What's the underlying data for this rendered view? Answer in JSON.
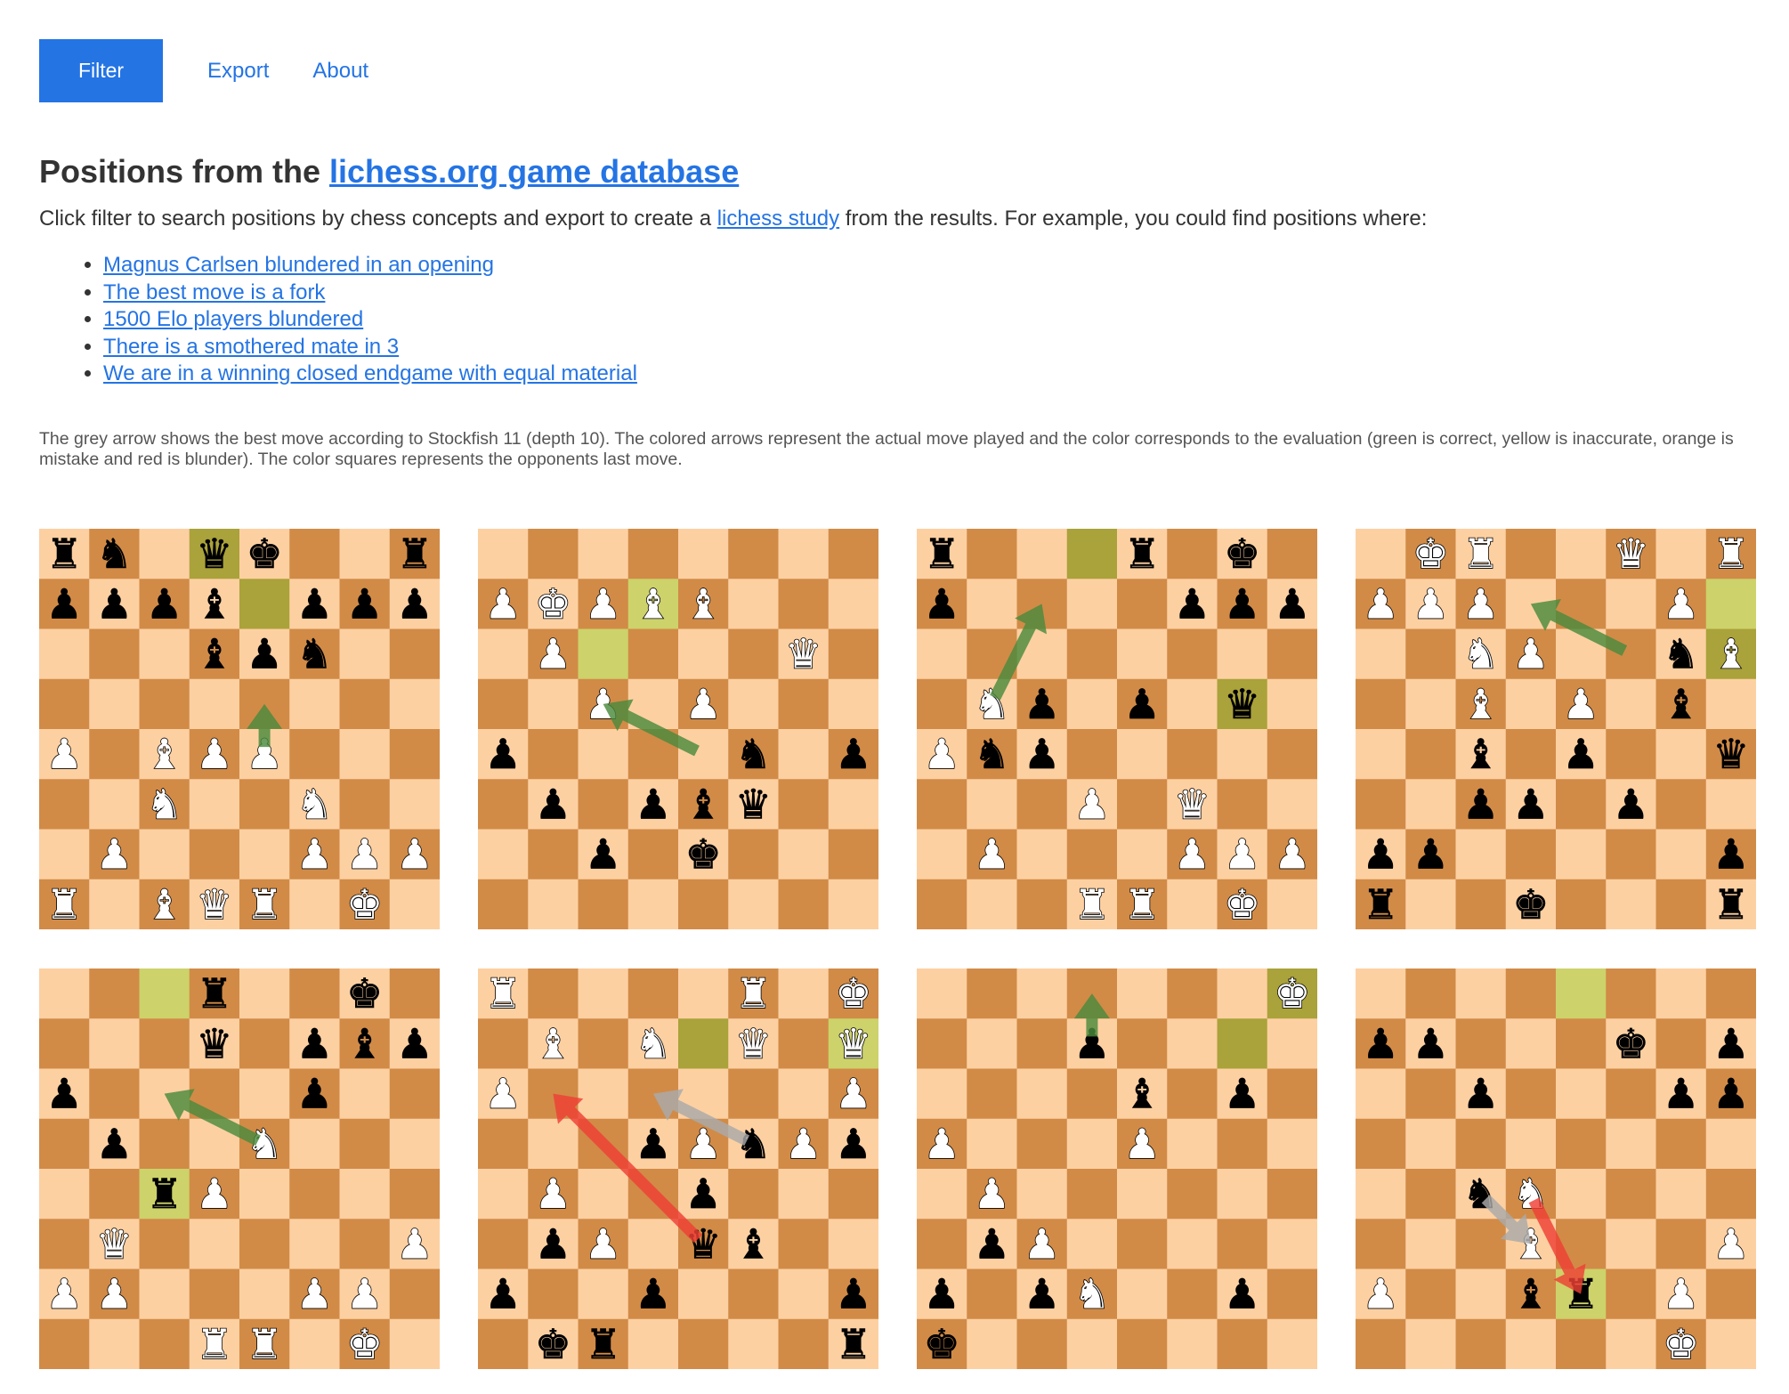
{
  "nav": {
    "filter_label": "Filter",
    "export_label": "Export",
    "about_label": "About"
  },
  "heading": {
    "prefix": "Positions from the ",
    "link": "lichess.org game database"
  },
  "intro": {
    "text1": "Click filter to search positions by chess concepts and export to create a ",
    "link": "lichess study",
    "text2": " from the results. For example, you could find positions where:"
  },
  "examples": [
    "Magnus Carlsen blundered in an opening",
    "The best move is a fork",
    "1500 Elo players blundered",
    "There is a smothered mate in 3",
    "We are in a winning closed endgame with equal material"
  ],
  "note": "The grey arrow shows the best move according to Stockfish 11 (depth 10). The colored arrows represent the actual move played and the color corresponds to the evaluation (green is correct, yellow is inaccurate, orange is mistake and red is blunder). The color squares represents the opponents last move.",
  "colors": {
    "light_square": "#fdd0a2",
    "dark_square": "#d18b47",
    "last_move_light": "#cdd26a",
    "last_move_dark": "#aaa23a",
    "arrow_green": "#4a8a3c",
    "arrow_red": "#ee4035",
    "arrow_grey": "#aaaaaa",
    "accent": "#2474e4"
  },
  "boards": [
    {
      "fen": "rn1qk2r/pppb1ppp/3bpn2/8/P1BPP3/2N2N2/1P3PPP/R1BQR1K1",
      "highlights": [
        "d8",
        "e7"
      ],
      "arrows": [
        {
          "from": "e4",
          "to": "e5",
          "color": "green"
        }
      ]
    },
    {
      "fen": "8/PKPBB3/1P4Q1/2P1P3/p4n1p/1p1pbq2/2p1k3/8",
      "highlights": [
        "d7",
        "c6"
      ],
      "arrows": [
        {
          "from": "e4",
          "to": "c5",
          "color": "green"
        }
      ]
    },
    {
      "fen": "r3r1k1/p4ppp/8/1Np1p1q1/Pnp5/3P1Q2/1P3PPP/3RR1K1",
      "highlights": [
        "d8",
        "g5"
      ],
      "arrows": [
        {
          "from": "b5",
          "to": "c7",
          "color": "green"
        }
      ]
    },
    {
      "fen": "1KR2Q1R/PPP3P1/2NP2nB/2B1P1b1/2b1p2q/2pp1p2/pp5p/r2k3r",
      "highlights": [
        "h7",
        "h6"
      ],
      "arrows": [
        {
          "from": "f6",
          "to": "d7",
          "color": "green"
        }
      ]
    },
    {
      "fen": "3r2k1/3q1pbp/p4p2/1p2N3/2rP4/1Q5P/PP3PP1/3RR1K1",
      "highlights": [
        "c8",
        "c4"
      ],
      "arrows": [
        {
          "from": "e5",
          "to": "c6",
          "color": "green"
        }
      ]
    },
    {
      "fen": "R4R1K/1B1N1Q1Q/P6P/3pPnPp/1P2p3/1pP1qb2/p2p3p/1kr4r",
      "highlights": [
        "e7",
        "h7"
      ],
      "arrows": [
        {
          "from": "e3",
          "to": "b6",
          "color": "red"
        },
        {
          "from": "f5",
          "to": "d6",
          "color": "grey"
        }
      ]
    },
    {
      "fen": "7K/3p4/4b1p1/P3P3/1P6/1pP5/p1pN2p1/k7",
      "highlights": [
        "h8",
        "g7"
      ],
      "arrows": [
        {
          "from": "d7",
          "to": "d8",
          "color": "green"
        }
      ]
    },
    {
      "fen": "8/pp3k1p/2p3pp/8/2nN4/3B3P/P2br1P1/6K1",
      "highlights": [
        "e8",
        "e2"
      ],
      "arrows": [
        {
          "from": "d4",
          "to": "e2",
          "color": "red"
        },
        {
          "from": "c4",
          "to": "d3",
          "color": "grey"
        }
      ]
    }
  ]
}
